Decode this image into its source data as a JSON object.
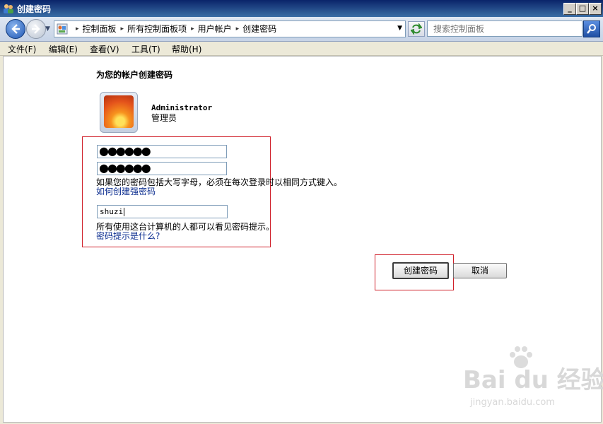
{
  "window": {
    "title": "创建密码",
    "icon": "users-icon",
    "controls": [
      "_",
      "□",
      "×"
    ]
  },
  "address": {
    "crumbs": [
      "控制面板",
      "所有控制面板项",
      "用户帐户",
      "创建密码"
    ],
    "search_placeholder": "搜索控制面板"
  },
  "menu": [
    "文件(F)",
    "编辑(E)",
    "查看(V)",
    "工具(T)",
    "帮助(H)"
  ],
  "page": {
    "heading": "为您的帐户创建密码",
    "user_name": "Administrator",
    "user_role": "管理员",
    "new_password_mask": "●●●●●●",
    "confirm_password_mask": "●●●●●●",
    "case_note": "如果您的密码包括大写字母，必须在每次登录时以相同方式键入。",
    "strong_password_link": "如何创建强密码",
    "hint_value": "shuzi",
    "hint_note": "所有使用这台计算机的人都可以看见密码提示。",
    "hint_link": "密码提示是什么?",
    "create_button": "创建密码",
    "cancel_button": "取消"
  },
  "watermark": {
    "main": "Bai du 经验",
    "sub": "jingyan.baidu.com"
  },
  "colors": {
    "highlight_border": "#d0202a",
    "link": "#0a2c8f"
  }
}
